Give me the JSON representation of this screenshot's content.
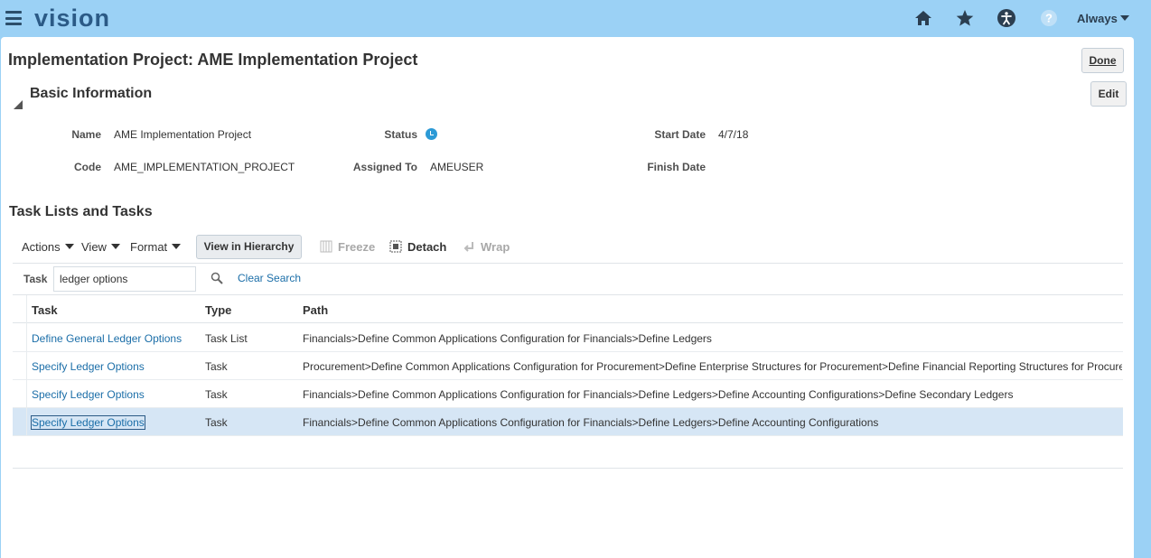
{
  "header": {
    "brand": "vision",
    "always_label": "Always",
    "icons": [
      "home-icon",
      "star-icon",
      "accessibility-icon",
      "help-icon"
    ],
    "accent": "#9bd1f5"
  },
  "page": {
    "title": "Implementation Project: AME Implementation Project",
    "done_label": "Done",
    "edit_label": "Edit"
  },
  "basic_info": {
    "title": "Basic Information",
    "name_label": "Name",
    "name_value": "AME Implementation Project",
    "code_label": "Code",
    "code_value": "AME_IMPLEMENTATION_PROJECT",
    "status_label": "Status",
    "assigned_label": "Assigned To",
    "assigned_value": "AMEUSER",
    "start_label": "Start Date",
    "start_value": "4/7/18",
    "finish_label": "Finish Date"
  },
  "tasks": {
    "title": "Task Lists and Tasks",
    "toolbar": {
      "actions": "Actions",
      "view": "View",
      "format": "Format",
      "hierarchy": "View in Hierarchy",
      "freeze": "Freeze",
      "detach": "Detach",
      "wrap": "Wrap"
    },
    "search": {
      "label": "Task",
      "value": "ledger options",
      "clear": "Clear Search"
    },
    "columns": [
      "Task",
      "Type",
      "Path"
    ],
    "rows": [
      {
        "task": "Define General Ledger Options",
        "type": "Task List",
        "path": "Financials>Define Common Applications Configuration for Financials>Define Ledgers"
      },
      {
        "task": "Specify Ledger Options",
        "type": "Task",
        "path": "Procurement>Define Common Applications Configuration for Procurement>Define Enterprise Structures for Procurement>Define Financial Reporting Structures for Procurement"
      },
      {
        "task": "Specify Ledger Options",
        "type": "Task",
        "path": "Financials>Define Common Applications Configuration for Financials>Define Ledgers>Define Accounting Configurations>Define Secondary Ledgers"
      },
      {
        "task": "Specify Ledger Options",
        "type": "Task",
        "path": "Financials>Define Common Applications Configuration for Financials>Define Ledgers>Define Accounting Configurations"
      }
    ]
  }
}
